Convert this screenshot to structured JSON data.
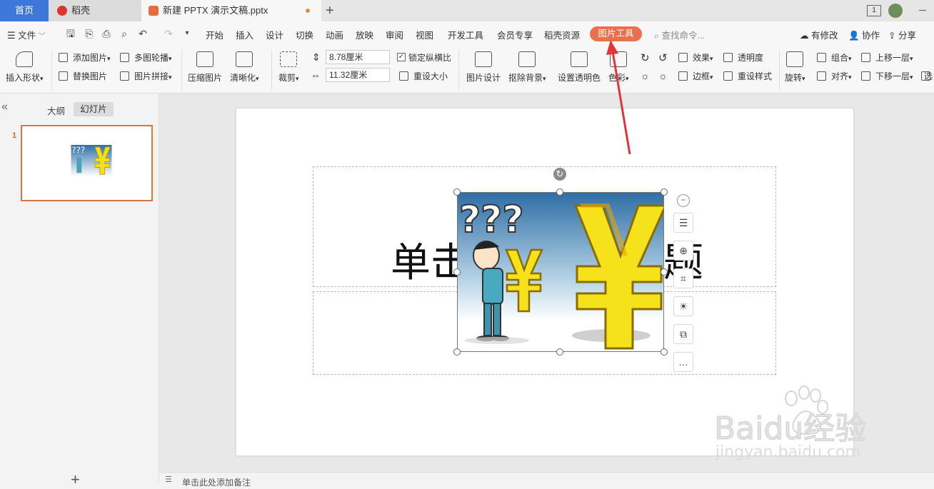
{
  "tabs": {
    "home": "首页",
    "daoke": "稻壳",
    "doc": "新建 PPTX 演示文稿.pptx",
    "add": "+"
  },
  "window": {
    "page_indicator": "1"
  },
  "menu": {
    "file": "文件",
    "items": [
      "开始",
      "插入",
      "设计",
      "切换",
      "动画",
      "放映",
      "审阅",
      "视图",
      "开发工具",
      "会员专享",
      "稻壳资源"
    ],
    "active": "图片工具",
    "search_placeholder": "查找命令...",
    "right": [
      "有修改",
      "协作",
      "分享"
    ]
  },
  "ribbon": {
    "insert_shape": "插入形状",
    "add_picture": "添加图片",
    "multi_carousel": "多图轮播",
    "replace_picture": "替换图片",
    "picture_mosaic": "图片拼接",
    "compress_picture": "压缩图片",
    "sharpen": "清晰化",
    "crop": "裁剪",
    "height_value": "8.78厘米",
    "width_value": "11.32厘米",
    "lock_ratio": "锁定纵横比",
    "reset_size": "重设大小",
    "picture_design": "图片设计",
    "remove_background": "抠除背景",
    "set_transparent_color": "设置透明色",
    "color": "色彩",
    "effects": "效果",
    "transparency": "透明度",
    "border": "边框",
    "reset_style": "重设样式",
    "rotate": "旋转",
    "group": "组合",
    "bring_forward": "上移一层",
    "align": "对齐",
    "send_backward": "下移一层",
    "select_pane": "选"
  },
  "panel": {
    "outline": "大纲",
    "slides": "幻灯片",
    "slide_number": "1",
    "add_slide": "+"
  },
  "slide": {
    "title_left": "单击",
    "title_right": "题",
    "picture_caption_marks": "???"
  },
  "notes": {
    "placeholder": "单击此处添加备注"
  },
  "watermark": {
    "brand": "Baidu经验",
    "url": "jingyan.baidu.com"
  },
  "colors": {
    "accent_blue": "#3d77d9",
    "picture_tool_orange": "#e8704a",
    "thumb_border": "#d2783f",
    "arrow_red": "#e0353b"
  },
  "icons": [
    "tab-close-dot",
    "save-icon",
    "print-icon",
    "undo-icon",
    "redo-icon",
    "search-icon",
    "rotate-icon",
    "layers-icon",
    "zoom-icon",
    "crop-icon",
    "bulb-icon",
    "replace-icon",
    "more-icon"
  ]
}
